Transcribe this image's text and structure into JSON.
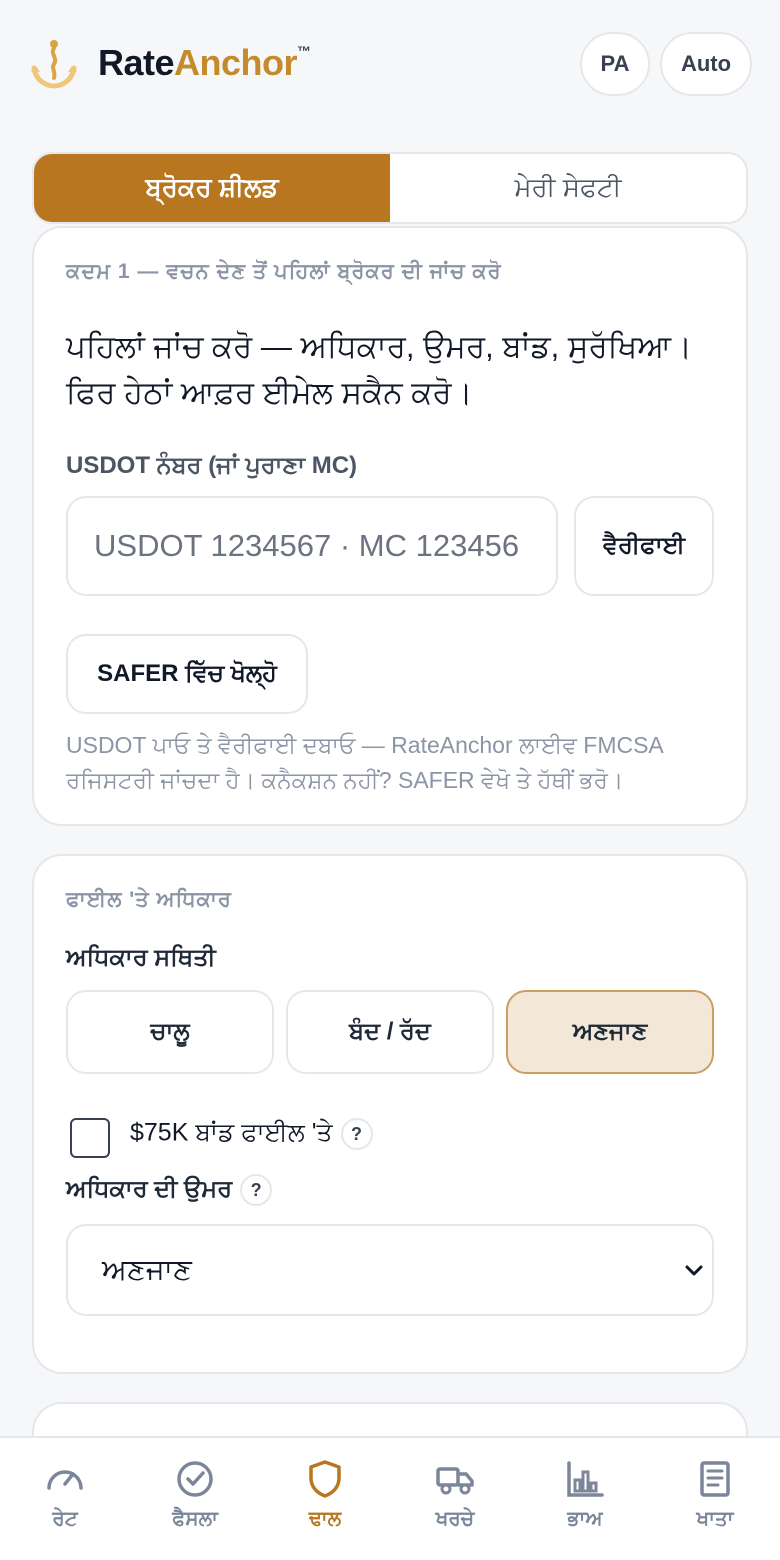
{
  "header": {
    "brand_part1": "Rate",
    "brand_part2": "Anchor",
    "brand_tm": "™",
    "language_pill": "PA",
    "auto_pill": "Auto",
    "brand_color": "#c58a2c"
  },
  "tabs": {
    "active_label": "ਬ੍ਰੋਕਰ ਸ਼ੀਲਡ",
    "inactive_label": "ਮੇਰੀ ਸੇਫਟੀ",
    "active_color": "#b8771f"
  },
  "step_card": {
    "kicker": "ਕਦਮ 1 — ਵਚਨ ਦੇਣ ਤੋਂ ਪਹਿਲਾਂ ਬ੍ਰੋਕਰ ਦੀ ਜਾਂਚ ਕਰੋ",
    "headline": "ਪਹਿਲਾਂ ਜਾਂਚ ਕਰੋ — ਅਧਿਕਾਰ, ਉਮਰ, ਬਾਂਡ, ਸੁਰੱਖਿਆ। ਫਿਰ ਹੇਠਾਂ ਆਫ਼ਰ ਈਮੇਲ ਸਕੈਨ ਕਰੋ।",
    "usdot_label": "USDOT ਨੰਬਰ (ਜਾਂ ਪੁਰਾਣਾ MC)",
    "usdot_placeholder": "USDOT 1234567 · MC 123456",
    "usdot_value": "",
    "verify_button": "ਵੈਰੀਫਾਈ",
    "safer_button": "SAFER ਵਿੱਚ ਖੋਲ੍ਹੋ",
    "helper_text": "USDOT ਪਾਓ ਤੇ ਵੈਰੀਫਾਈ ਦਬਾਓ — RateAnchor ਲਾਈਵ FMCSA ਰਜਿਸਟਰੀ ਜਾਂਚਦਾ ਹੈ। ਕਨੈਕਸ਼ਨ ਨਹੀਂ? SAFER ਵੇਖੋ ਤੇ ਹੱਥੀਂ ਭਰੋ।"
  },
  "authority_card": {
    "kicker": "ਫਾਈਲ 'ਤੇ ਅਧਿਕਾਰ",
    "status_label": "ਅਧਿਕਾਰ ਸਥਿਤੀ",
    "status_options": [
      "ਚਾਲੂ",
      "ਬੰਦ / ਰੱਦ",
      "ਅਣਜਾਣ"
    ],
    "status_selected": "ਅਣਜਾਣ",
    "bond_label": "$75K ਬਾਂਡ ਫਾਈਲ 'ਤੇ",
    "bond_checked": false,
    "help_glyph": "?",
    "age_label": "ਅਧਿਕਾਰ ਦੀ ਉਮਰ",
    "age_selected": "ਅਣਜਾਣ"
  },
  "bottom_nav": {
    "items": [
      {
        "label": "ਰੇਟ",
        "icon": "gauge-icon"
      },
      {
        "label": "ਫੈਸਲਾ",
        "icon": "check-circle-icon"
      },
      {
        "label": "ਢਾਲ",
        "icon": "shield-icon"
      },
      {
        "label": "ਖਰਚੇ",
        "icon": "truck-icon"
      },
      {
        "label": "ਭਾਅ",
        "icon": "bar-chart-icon"
      },
      {
        "label": "ਖਾਤਾ",
        "icon": "document-icon"
      }
    ],
    "active_index": 2,
    "active_color": "#b8771f",
    "inactive_color": "#7b8699"
  }
}
